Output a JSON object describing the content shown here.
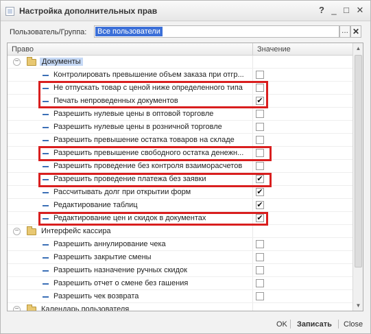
{
  "window": {
    "title": "Настройка дополнительных прав",
    "help": "?",
    "minimize": "_",
    "maximize": "□",
    "close": "✕"
  },
  "user": {
    "label": "Пользователь/Группа:",
    "value": "Все пользователи",
    "select_btn": "...",
    "clear_btn": "✕"
  },
  "grid": {
    "columns": {
      "right": "Право",
      "value": "Значение"
    },
    "group_documents": "Документы",
    "documents": [
      {
        "label": "Контролировать превышение объем заказа при отгр...",
        "checked": false
      },
      {
        "label": "Не отпускать товар с ценой ниже определенного типа",
        "checked": false
      },
      {
        "label": "Печать непроведенных документов",
        "checked": true
      },
      {
        "label": "Разрешить нулевые цены в оптовой торговле",
        "checked": false
      },
      {
        "label": "Разрешить нулевые цены в розничной торговле",
        "checked": false
      },
      {
        "label": "Разрешить превышение остатка товаров на складе",
        "checked": false
      },
      {
        "label": "Разрешить превышение свободного остатка денежн...",
        "checked": false
      },
      {
        "label": "Разрешить проведение без контроля взаиморасчетов",
        "checked": false
      },
      {
        "label": "Разрешить проведение платежа без заявки",
        "checked": true
      },
      {
        "label": "Рассчитывать долг при открытии форм",
        "checked": true
      },
      {
        "label": "Редактирование таблиц",
        "checked": true
      },
      {
        "label": "Редактирование цен и скидок в документах",
        "checked": true
      }
    ],
    "group_cashier": "Интерфейс кассира",
    "cashier": [
      {
        "label": "Разрешить аннулирование чека",
        "checked": false
      },
      {
        "label": "Разрешить закрытие смены",
        "checked": false
      },
      {
        "label": "Разрешить назначение ручных скидок",
        "checked": false
      },
      {
        "label": "Разрешить отчет о смене без гашения",
        "checked": false
      },
      {
        "label": "Разрешить чек возврата",
        "checked": false
      }
    ],
    "group_calendar": "Календарь пользователя"
  },
  "footer": {
    "ok": "OK",
    "save": "Записать",
    "close": "Close"
  },
  "colors": {
    "highlight": "#d91e1e",
    "selection": "#3b6fd8"
  }
}
